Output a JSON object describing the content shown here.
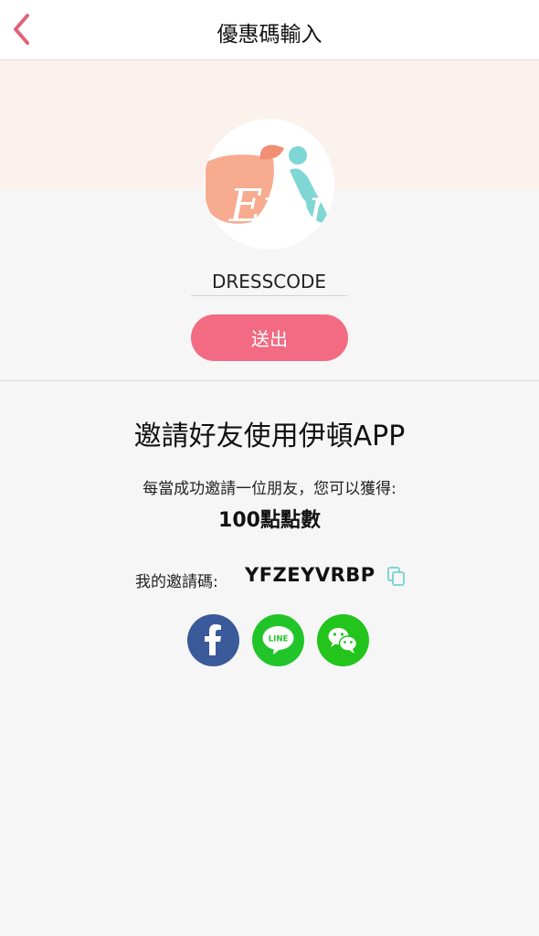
{
  "header": {
    "title": "優惠碼輸入",
    "back_icon": "chevron-left-icon",
    "accent_color": "#e0637a"
  },
  "logo": {
    "text": "Eton"
  },
  "promo": {
    "input_value": "DRESSCODE",
    "submit_label": "送出",
    "submit_color": "#f26b82"
  },
  "invite": {
    "title": "邀請好友使用伊頓APP",
    "description": "每當成功邀請一位朋友，您可以獲得:",
    "reward": "100點點數",
    "my_code_label": "我的邀請碼:",
    "my_code": "YFZEYVRBP"
  },
  "share": {
    "facebook_icon": "facebook-icon",
    "line_icon": "line-icon",
    "line_text": "LINE",
    "wechat_icon": "wechat-icon"
  }
}
